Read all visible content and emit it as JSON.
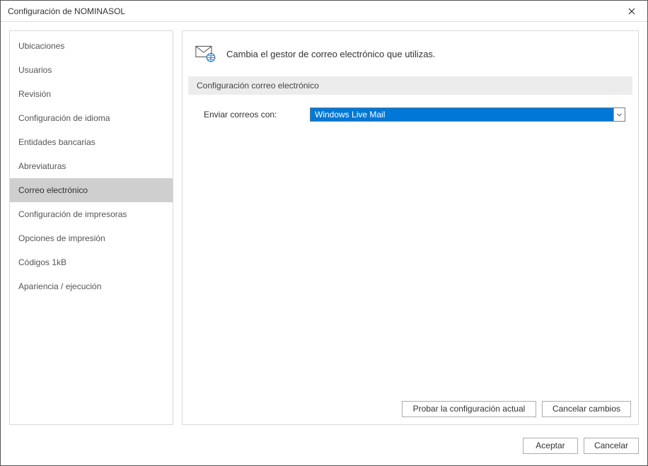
{
  "window": {
    "title": "Configuración de NOMINASOL"
  },
  "sidebar": {
    "items": [
      {
        "label": "Ubicaciones"
      },
      {
        "label": "Usuarios"
      },
      {
        "label": "Revisión"
      },
      {
        "label": "Configuración de idioma"
      },
      {
        "label": "Entidades bancarias"
      },
      {
        "label": "Abreviaturas"
      },
      {
        "label": "Correo electrónico"
      },
      {
        "label": "Configuración de impresoras"
      },
      {
        "label": "Opciones de impresión"
      },
      {
        "label": "Códigos 1kB"
      },
      {
        "label": "Apariencia / ejecución"
      }
    ],
    "selected_index": 6
  },
  "panel": {
    "description": "Cambia el gestor de correo electrónico que utilizas.",
    "section_title": "Configuración correo electrónico",
    "field_label": "Enviar correos con:",
    "combo_value": "Windows Live Mail",
    "test_button": "Probar la configuración actual",
    "cancel_changes_button": "Cancelar cambios"
  },
  "dialog": {
    "ok": "Aceptar",
    "cancel": "Cancelar"
  }
}
